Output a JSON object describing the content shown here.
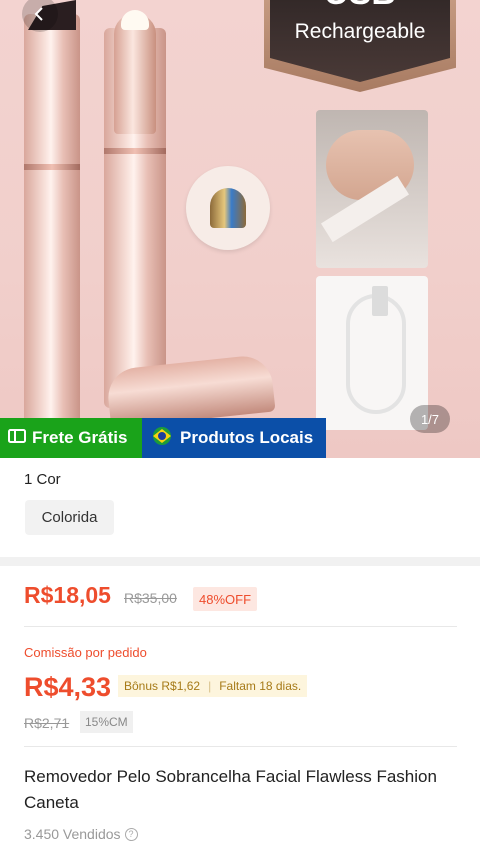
{
  "hero": {
    "badge_line1": "USB",
    "badge_line2": "Rechargeable",
    "image_counter": "1/7",
    "back_icon": "arrow-left-icon"
  },
  "banner": {
    "free_shipping": "Frete Grátis",
    "local_products": "Produtos Locais",
    "free_shipping_color": "#1aa31a",
    "local_products_color": "#0b4fa8"
  },
  "variants": {
    "count_label": "1 Cor",
    "options": [
      "Colorida"
    ]
  },
  "price": {
    "current": "R$18,05",
    "original": "R$35,00",
    "discount": "48%OFF",
    "accent_color": "#ee4d2d"
  },
  "commission": {
    "label": "Comissão por pedido",
    "value": "R$4,33",
    "bonus": "Bônus R$1,62",
    "days_left": "Faltam 18 dias.",
    "original": "R$2,71",
    "rate": "15%CM"
  },
  "product": {
    "title": "Removedor Pelo Sobrancelha Facial Flawless Fashion Caneta",
    "sold": "3.450 Vendidos"
  }
}
